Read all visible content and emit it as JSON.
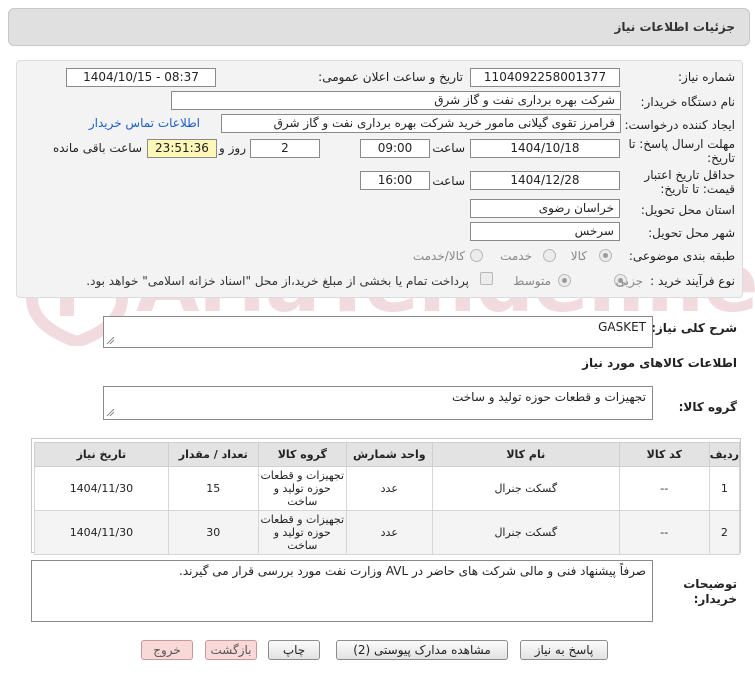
{
  "header": {
    "title": "جزئیات اطلاعات نیاز"
  },
  "form": {
    "need_number_label": "شماره نیاز:",
    "need_number": "1104092258001377",
    "announce_label": "تاریخ و ساعت اعلان عمومی:",
    "announce_value": "1404/10/15 - 08:37",
    "buyer_org_label": "نام دستگاه خریدار:",
    "buyer_org": "شرکت بهره برداری نفت و گاز شرق",
    "creator_label": "ایجاد کننده درخواست:",
    "creator": "فرامرز تقوی گیلانی مامور خرید شرکت بهره برداری نفت و گاز شرق",
    "contact_link": "اطلاعات تماس خریدار",
    "deadline_label_1": "مهلت ارسال پاسخ: تا",
    "deadline_label_2": "تاریخ:",
    "deadline_date": "1404/10/18",
    "time_label": "ساعت",
    "deadline_time": "09:00",
    "days_value": "2",
    "days_label": "روز و",
    "remaining_time": "23:51:36",
    "remaining_label": "ساعت باقی مانده",
    "validity_label_1": "حداقل تاریخ اعتبار",
    "validity_label_2": "قیمت: تا تاریخ:",
    "validity_date": "1404/12/28",
    "validity_time": "16:00",
    "province_label": "استان محل تحویل:",
    "province": "خراسان رضوی",
    "city_label": "شهر محل تحویل:",
    "city": "سرخس",
    "category_label": "طبقه بندی موضوعی:",
    "category_options": [
      "کالا",
      "خدمت",
      "کالا/خدمت"
    ],
    "category_selected": "کالا",
    "process_label": "نوع فرآیند خرید :",
    "process_options": [
      "جزیی",
      "متوسط"
    ],
    "process_selected": "جزیی",
    "payment_note": "پرداخت تمام یا بخشی از مبلغ خرید،از محل \"اسناد خزانه اسلامی\" خواهد بود."
  },
  "summary": {
    "label": "شرح کلی نیاز:",
    "value": "GASKET"
  },
  "goods_info_title": "اطلاعات کالاهای مورد نیاز",
  "goods_group": {
    "label": "گروه کالا:",
    "value": "تجهیزات و قطعات حوزه تولید و ساخت"
  },
  "table": {
    "headers": [
      "ردیف",
      "کد کالا",
      "نام کالا",
      "واحد شمارش",
      "گروه کالا",
      "تعداد / مقدار",
      "تاریخ نیاز"
    ],
    "rows": [
      [
        "1",
        "--",
        "گسکت جنرال",
        "عدد",
        "تجهیزات و قطعات حوزه تولید و ساخت",
        "15",
        "1404/11/30"
      ],
      [
        "2",
        "--",
        "گسکت جنرال",
        "عدد",
        "تجهیزات و قطعات حوزه تولید و ساخت",
        "30",
        "1404/11/30"
      ]
    ]
  },
  "buyer_notes": {
    "label_1": "توضیحات",
    "label_2": "خریدار:",
    "value": "صرفاً پیشنهاد فنی و مالی شرکت های حاضر در AVL وزارت نفت مورد بررسی قرار می گیرند."
  },
  "buttons": {
    "reply": "پاسخ به نیاز",
    "attachments": "مشاهده مدارک پیوستی (2)",
    "print": "چاپ",
    "back": "بازگشت",
    "exit": "خروج"
  },
  "watermark": {
    "text": "AriaTender.neT"
  }
}
